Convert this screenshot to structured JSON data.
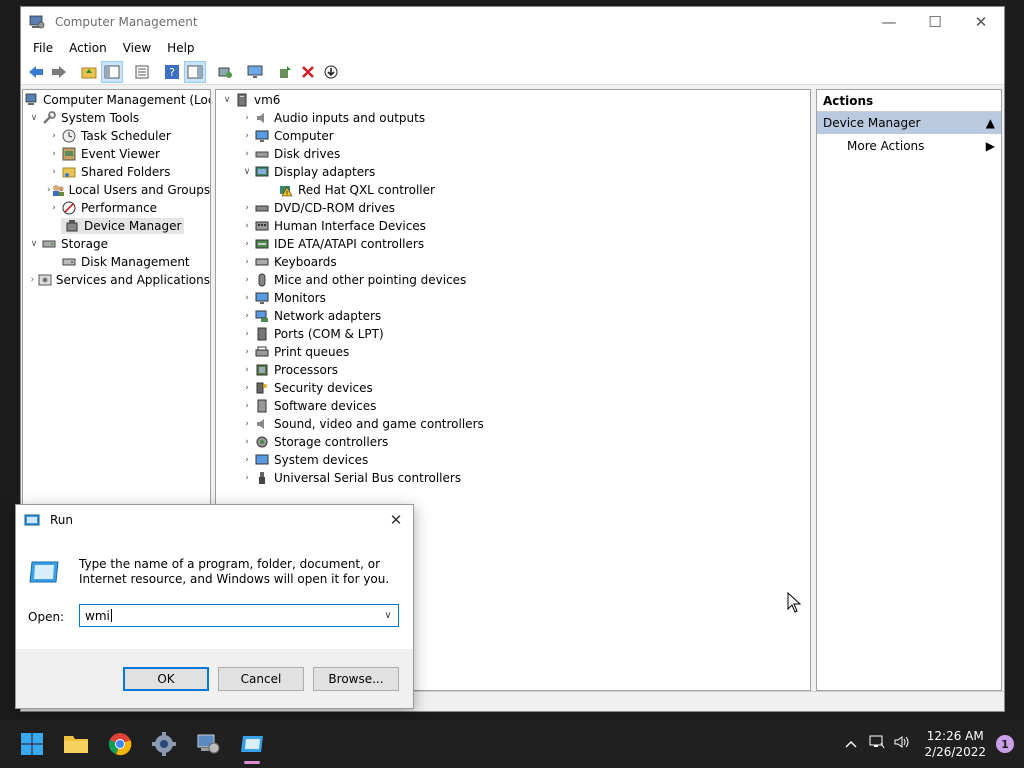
{
  "window": {
    "title": "Computer Management",
    "controls": {
      "minimize": "—",
      "maximize": "☐",
      "close": "✕"
    }
  },
  "menu": [
    "File",
    "Action",
    "View",
    "Help"
  ],
  "left_tree": {
    "root": "Computer Management (Local",
    "system_tools": "System Tools",
    "task_scheduler": "Task Scheduler",
    "event_viewer": "Event Viewer",
    "shared_folders": "Shared Folders",
    "local_users": "Local Users and Groups",
    "performance": "Performance",
    "device_manager": "Device Manager",
    "storage": "Storage",
    "disk_management": "Disk Management",
    "services": "Services and Applications"
  },
  "device_tree": {
    "root": "vm6",
    "items": [
      "Audio inputs and outputs",
      "Computer",
      "Disk drives",
      "Display adapters",
      "Red Hat QXL controller",
      "DVD/CD-ROM drives",
      "Human Interface Devices",
      "IDE ATA/ATAPI controllers",
      "Keyboards",
      "Mice and other pointing devices",
      "Monitors",
      "Network adapters",
      "Ports (COM & LPT)",
      "Print queues",
      "Processors",
      "Security devices",
      "Software devices",
      "Sound, video and game controllers",
      "Storage controllers",
      "System devices",
      "Universal Serial Bus controllers"
    ]
  },
  "actions": {
    "header": "Actions",
    "section": "Device Manager",
    "more": "More Actions"
  },
  "run_dialog": {
    "title": "Run",
    "description": "Type the name of a program, folder, document, or Internet resource, and Windows will open it for you.",
    "open_label": "Open:",
    "value": "wmi",
    "ok": "OK",
    "cancel": "Cancel",
    "browse": "Browse..."
  },
  "taskbar": {
    "time": "12:26 AM",
    "date": "2/26/2022",
    "notifications": "1"
  }
}
